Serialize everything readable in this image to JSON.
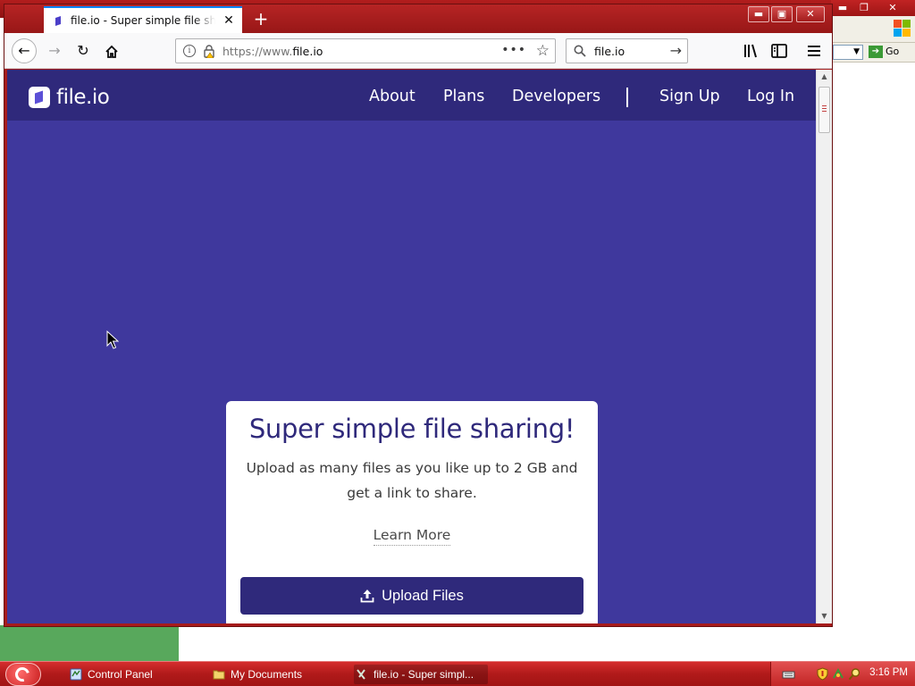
{
  "browser": {
    "tab_title": "file.io - Super simple file sharing!",
    "url_prefix": "https://www.",
    "url_domain": "file.io",
    "search_value": "file.io"
  },
  "site": {
    "logo_text": "file.io",
    "nav": [
      "About",
      "Plans",
      "Developers",
      "Sign Up",
      "Log In"
    ],
    "card": {
      "title": "Super simple file sharing!",
      "subtitle": "Upload as many files as you like up to 2 GB and get a link to share.",
      "learn_more": "Learn More",
      "upload_button": "Upload Files"
    }
  },
  "background_window": {
    "go_label": "Go"
  },
  "taskbar": {
    "items": [
      "Control Panel",
      "My Documents",
      "file.io - Super simpl..."
    ],
    "clock": "3:16 PM"
  },
  "colors": {
    "page_bg": "#3f389d",
    "header_bg": "#2f297b",
    "button_bg": "#2f297b",
    "window_frame": "#a71c1c"
  }
}
